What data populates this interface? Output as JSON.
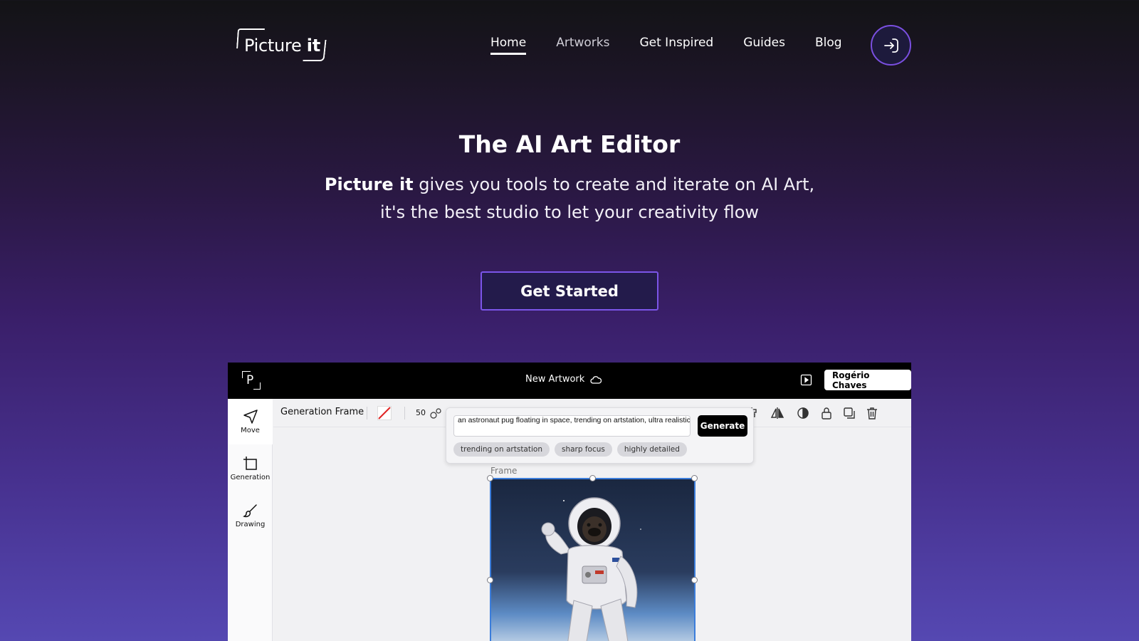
{
  "brand": {
    "logo_text": "Picture",
    "logo_bold": "it"
  },
  "nav": {
    "items": [
      {
        "label": "Home",
        "state": "active"
      },
      {
        "label": "Artworks",
        "state": "muted"
      },
      {
        "label": "Get Inspired",
        "state": "normal"
      },
      {
        "label": "Guides",
        "state": "normal"
      },
      {
        "label": "Blog",
        "state": "normal"
      }
    ],
    "login_icon": "login-arrow-icon"
  },
  "hero": {
    "title": "The AI Art Editor",
    "subtitle_bold": "Picture it",
    "subtitle_rest": " gives you tools to create and iterate on AI Art,",
    "subtitle_line2": "it's the best studio to let your creativity flow",
    "cta": "Get Started"
  },
  "app": {
    "title": "New Artwork",
    "user": "Rogério Chaves",
    "tools": [
      {
        "label": "Move",
        "icon": "cursor-arrow-icon"
      },
      {
        "label": "Generation",
        "icon": "frame-crop-icon"
      },
      {
        "label": "Drawing",
        "icon": "brush-icon"
      }
    ],
    "toolbar": {
      "label": "Generation Frame",
      "brush_size": "50"
    },
    "prompt": {
      "value": "an astronaut pug floating in space, trending on artstation, ultra realistic",
      "generate": "Generate",
      "chips": [
        "trending on artstation",
        "sharp focus",
        "highly detailed"
      ]
    },
    "frame_label": "Frame"
  },
  "colors": {
    "accent": "#7b55e8",
    "frame_border": "#3b7ddb"
  }
}
